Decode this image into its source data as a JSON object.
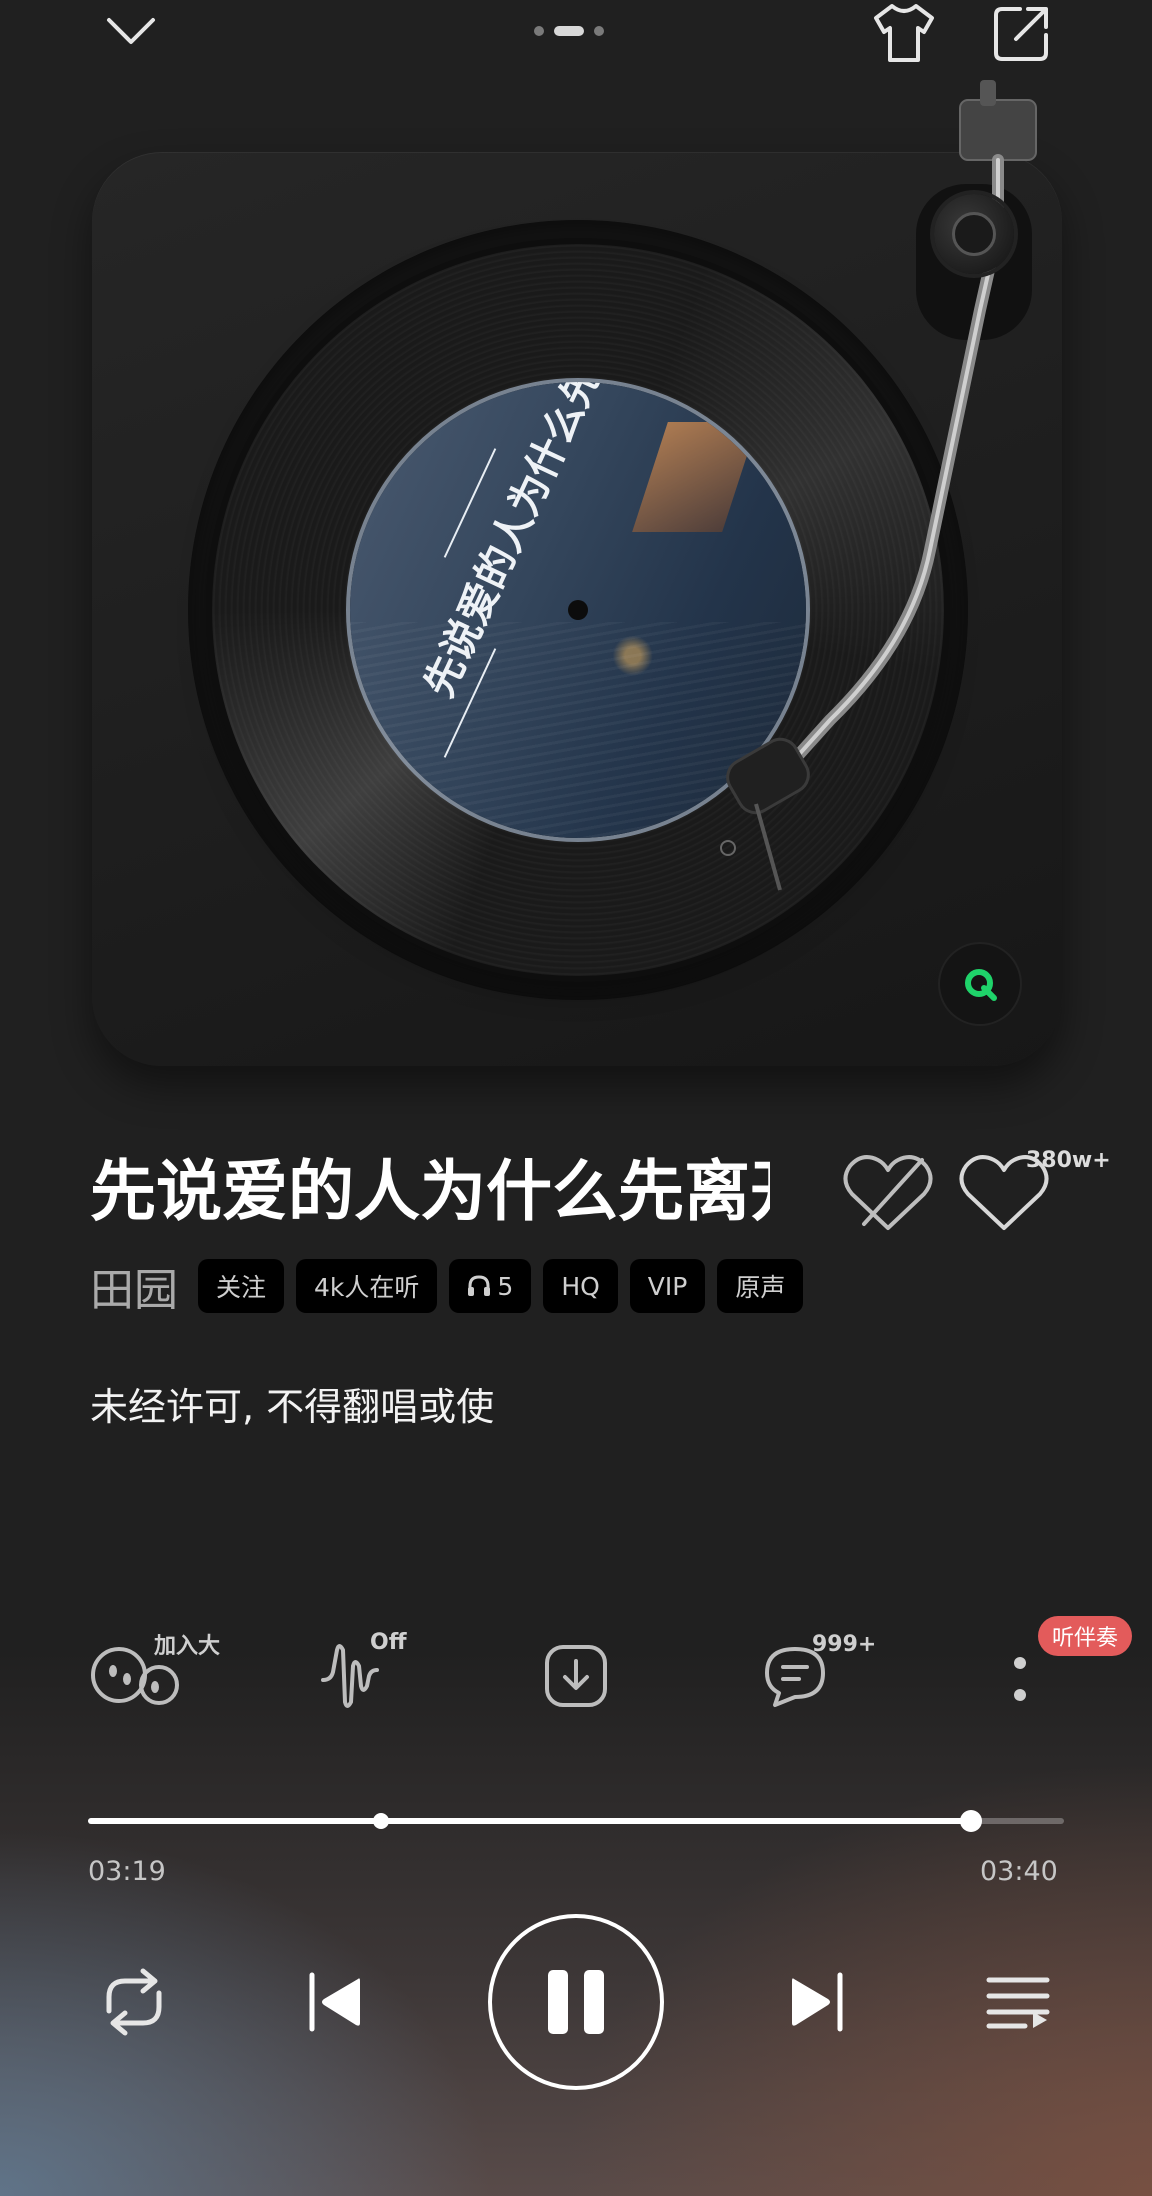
{
  "header": {
    "collapse_icon": "chevron-down-icon",
    "skin_icon": "tshirt-icon",
    "share_icon": "share-icon",
    "page_dots": 3,
    "active_page_index": 1
  },
  "player_art": {
    "label_title": "先说爱的人为什么先离开",
    "app_badge_letter": "Q",
    "app_badge_color": "#1fd36a"
  },
  "song": {
    "title": "先说爱的人为什么先离开",
    "artist": "田园",
    "like_count": "380w+",
    "tags": [
      {
        "label": "关注"
      },
      {
        "label": "4k人在听"
      },
      {
        "label": "5",
        "icon": "headphones-icon"
      },
      {
        "label": "HQ"
      },
      {
        "label": "VIP"
      },
      {
        "label": "原声"
      }
    ],
    "notice": "未经许可, 不得翻唱或使"
  },
  "actions": {
    "listen_together_label": "加入大",
    "sound_effect_label": "Off",
    "comment_count": "999+",
    "accompaniment_label": "听伴奏"
  },
  "progress": {
    "elapsed": "03:19",
    "total": "03:40",
    "played_fraction": 0.905,
    "marker_fraction": 0.3
  },
  "controls": {
    "repeat_icon": "repeat-icon",
    "prev_icon": "previous-icon",
    "pause_icon": "pause-icon",
    "next_icon": "next-icon",
    "playlist_icon": "playlist-icon"
  },
  "colors": {
    "background": "#202020",
    "accent_badge": "#e35b5b",
    "text_primary": "#ffffff",
    "text_secondary": "#aaaaaa"
  }
}
